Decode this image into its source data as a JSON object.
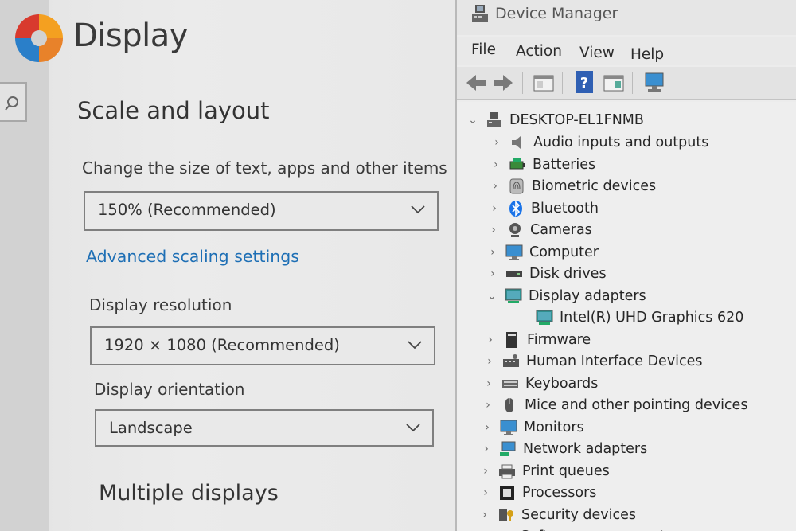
{
  "settings": {
    "page_title": "Display",
    "scale_heading": "Scale and layout",
    "scale_label": "Change the size of text, apps and other items",
    "scale_value": "150% (Recommended)",
    "advanced_link": "Advanced scaling settings",
    "resolution_label": "Display resolution",
    "resolution_value": "1920 × 1080 (Recommended)",
    "orientation_label": "Display orientation",
    "orientation_value": "Landscape",
    "multiple_heading": "Multiple displays"
  },
  "device_manager": {
    "title": "Device Manager",
    "menu": [
      "File",
      "Action",
      "View",
      "Help"
    ],
    "toolbar": [
      "back-icon",
      "forward-icon",
      "properties-icon",
      "help-icon",
      "update-driver-icon",
      "scan-hardware-icon"
    ],
    "root": "DESKTOP-EL1FNMB",
    "tree": [
      {
        "label": "Audio inputs and outputs",
        "icon": "speaker-icon",
        "expanded": false
      },
      {
        "label": "Batteries",
        "icon": "battery-icon",
        "expanded": false
      },
      {
        "label": "Biometric devices",
        "icon": "fingerprint-icon",
        "expanded": false
      },
      {
        "label": "Bluetooth",
        "icon": "bluetooth-icon",
        "expanded": false
      },
      {
        "label": "Cameras",
        "icon": "camera-icon",
        "expanded": false
      },
      {
        "label": "Computer",
        "icon": "monitor-icon",
        "expanded": false
      },
      {
        "label": "Disk drives",
        "icon": "disk-drive-icon",
        "expanded": false
      },
      {
        "label": "Display adapters",
        "icon": "display-adapter-icon",
        "expanded": true
      },
      {
        "label": "Intel(R) UHD Graphics 620",
        "icon": "display-adapter-icon",
        "child": true
      },
      {
        "label": "Firmware",
        "icon": "firmware-icon",
        "expanded": false
      },
      {
        "label": "Human Interface Devices",
        "icon": "hid-icon",
        "expanded": false
      },
      {
        "label": "Keyboards",
        "icon": "keyboard-icon",
        "expanded": false
      },
      {
        "label": "Mice and other pointing devices",
        "icon": "mouse-icon",
        "expanded": false
      },
      {
        "label": "Monitors",
        "icon": "monitor-icon",
        "expanded": false
      },
      {
        "label": "Network adapters",
        "icon": "network-adapter-icon",
        "expanded": false
      },
      {
        "label": "Print queues",
        "icon": "printer-icon",
        "expanded": false
      },
      {
        "label": "Processors",
        "icon": "processor-icon",
        "expanded": false
      },
      {
        "label": "Security devices",
        "icon": "security-device-icon",
        "expanded": false
      },
      {
        "label": "Software components",
        "icon": "software-component-icon",
        "expanded": false
      }
    ]
  },
  "colors": {
    "link": "#1e6fb5",
    "background": "#ebebeb"
  }
}
